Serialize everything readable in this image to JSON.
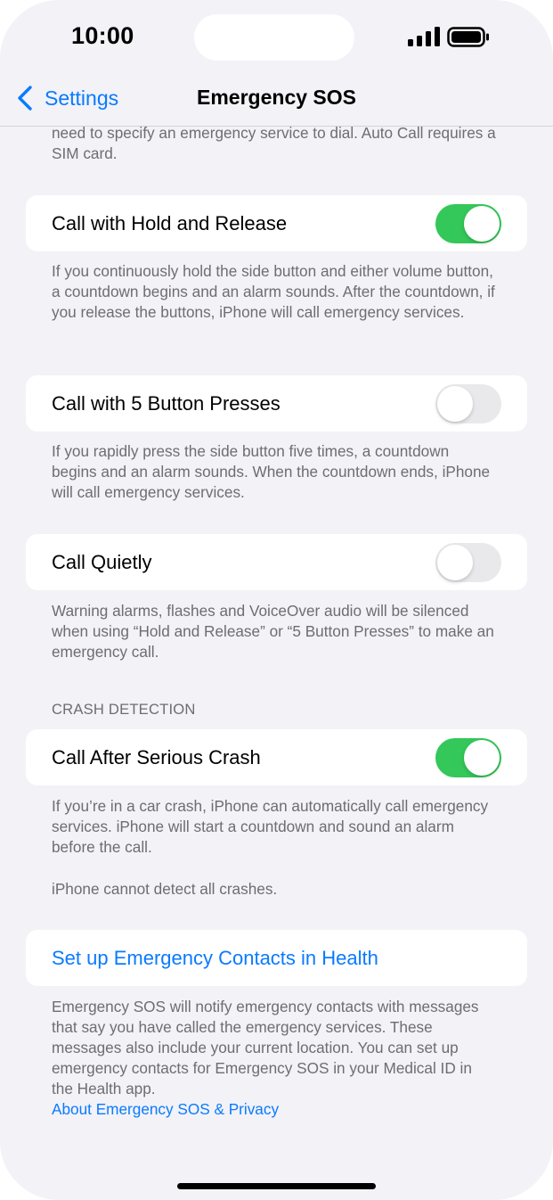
{
  "status_bar": {
    "time": "10:00"
  },
  "nav": {
    "back_label": "Settings",
    "title": "Emergency SOS"
  },
  "top_footnote": "need to specify an emergency service to dial. Auto Call requires a SIM card.",
  "settings": [
    {
      "label": "Call with Hold and Release",
      "enabled": true,
      "footnote": "If you continuously hold the side button and either volume button, a countdown begins and an alarm sounds. After the countdown, if you release the buttons, iPhone will call emergency services."
    },
    {
      "label": "Call with 5 Button Presses",
      "enabled": false,
      "footnote": "If you rapidly press the side button five times, a countdown begins and an alarm sounds. When the countdown ends, iPhone will call emergency services."
    },
    {
      "label": "Call Quietly",
      "enabled": false,
      "footnote": "Warning alarms, flashes and VoiceOver audio will be silenced when using “Hold and Release” or “5 Button Presses” to make an emergency call."
    }
  ],
  "crash_detection": {
    "header": "CRASH DETECTION",
    "label": "Call After Serious Crash",
    "enabled": true,
    "footnote_1": "If you’re in a car crash, iPhone can automatically call emergency services. iPhone will start a countdown and sound an alarm before the call.",
    "footnote_2": "iPhone cannot detect all crashes."
  },
  "emergency_contacts": {
    "link_label": "Set up Emergency Contacts in Health",
    "footnote": "Emergency SOS will notify emergency contacts with messages that say you have called the emergency services. These messages also include your current location. You can set up emergency contacts for Emergency SOS in your Medical ID in the Health app.",
    "privacy_link": "About Emergency SOS & Privacy"
  },
  "colors": {
    "accent": "#0a7aff",
    "toggle_on": "#34c759",
    "toggle_off": "#e9e9eb",
    "background": "#f2f2f7",
    "footnote_text": "#6d6d72"
  },
  "icons": [
    "cellular-signal-icon",
    "battery-icon",
    "chevron-left-icon"
  ]
}
